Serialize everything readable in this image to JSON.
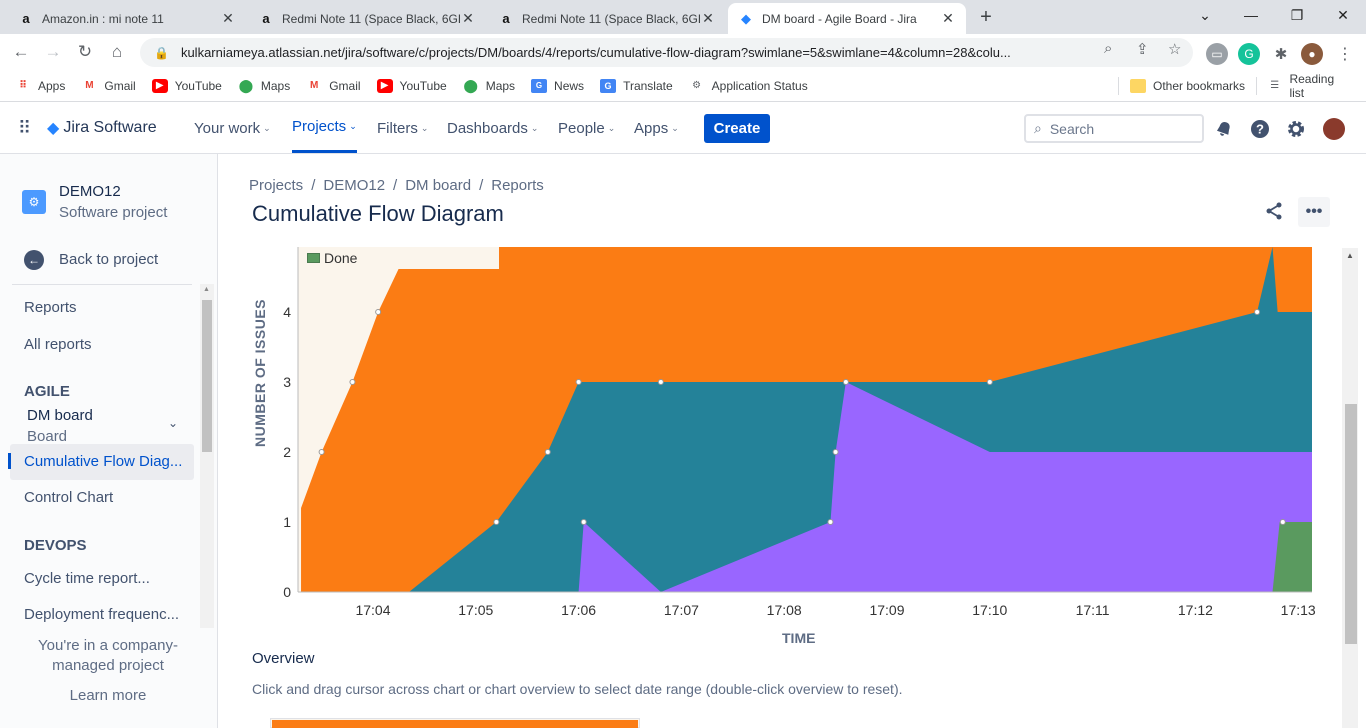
{
  "browser": {
    "tabs": [
      {
        "icon": "amazon-icon",
        "title": "Amazon.in : mi note 11",
        "active": false
      },
      {
        "icon": "amazon-icon",
        "title": "Redmi Note 11 (Space Black, 6GB",
        "active": false
      },
      {
        "icon": "amazon-icon",
        "title": "Redmi Note 11 (Space Black, 6GB",
        "active": false
      },
      {
        "icon": "jira-icon",
        "title": "DM board - Agile Board - Jira",
        "active": true
      }
    ],
    "url": "kulkarniameya.atlassian.net/jira/software/c/projects/DM/boards/4/reports/cumulative-flow-diagram?swimlane=5&swimlane=4&column=28&colu...",
    "bookmarks": [
      "Apps",
      "Gmail",
      "YouTube",
      "Maps",
      "Gmail",
      "YouTube",
      "Maps",
      "News",
      "Translate",
      "Application Status"
    ],
    "other_bookmarks": "Other bookmarks",
    "reading_list": "Reading list"
  },
  "jira": {
    "product": "Jira Software",
    "nav": [
      "Your work",
      "Projects",
      "Filters",
      "Dashboards",
      "People",
      "Apps"
    ],
    "active_nav": "Projects",
    "create": "Create",
    "search_placeholder": "Search"
  },
  "sidebar": {
    "project_name": "DEMO12",
    "project_type": "Software project",
    "back": "Back to project",
    "reports": "Reports",
    "all_reports": "All reports",
    "agile_head": "AGILE",
    "board_name": "DM board",
    "board_sub": "Board",
    "cfd": "Cumulative Flow Diag...",
    "control_chart": "Control Chart",
    "devops_head": "DEVOPS",
    "cycle_time": "Cycle time report...",
    "deployment": "Deployment frequenc...",
    "company_managed": "You're in a company-managed project",
    "learn_more": "Learn more"
  },
  "main": {
    "breadcrumbs": [
      "Projects",
      "DEMO12",
      "DM board",
      "Reports"
    ],
    "title": "Cumulative Flow Diagram",
    "overview_heading": "Overview",
    "overview_text": "Click and drag cursor across chart or chart overview to select date range (double-click overview to reset)."
  },
  "chart_data": {
    "type": "area",
    "xlabel": "TIME",
    "ylabel": "NUMBER OF ISSUES",
    "x_ticks": [
      "17:04",
      "17:05",
      "17:06",
      "17:07",
      "17:08",
      "17:09",
      "17:10",
      "17:11",
      "17:12",
      "17:13"
    ],
    "y_ticks": [
      0,
      1,
      2,
      3,
      4
    ],
    "legend": [
      "Done"
    ],
    "colors": {
      "done": "#5a9a5f",
      "in_review": "#9966ff",
      "in_progress": "#248299",
      "to_do": "#fb7c14",
      "background": "#fbf5ec"
    },
    "series": [
      {
        "name": "Done",
        "points": [
          [
            "17:03.3",
            0
          ],
          [
            "17:12.75",
            0
          ],
          [
            "17:12.82",
            1
          ],
          [
            "17:13.25",
            1
          ]
        ]
      },
      {
        "points": [
          [
            "17:06",
            0
          ],
          [
            "17:06.05",
            1
          ],
          [
            "17:06.8",
            0
          ],
          [
            "17:08.45",
            1
          ],
          [
            "17:08.5",
            2
          ],
          [
            "17:08.6",
            3
          ],
          [
            "17:10",
            2
          ],
          [
            "17:13.25",
            2
          ]
        ]
      },
      {
        "points": [
          [
            "17:04.35",
            0
          ],
          [
            "17:05.2",
            1
          ],
          [
            "17:05.7",
            2
          ],
          [
            "17:06",
            3
          ],
          [
            "17:10",
            3
          ],
          [
            "17:12.6",
            4
          ],
          [
            "17:12.75",
            5
          ],
          [
            "17:12.8",
            4
          ],
          [
            "17:13.25",
            4
          ]
        ]
      },
      {
        "points": [
          [
            "17:03.3",
            1.2
          ],
          [
            "17:03.5",
            2
          ],
          [
            "17:03.8",
            3
          ],
          [
            "17:04.05",
            4
          ],
          [
            "17:04.35",
            5
          ],
          [
            "17:13.25",
            5
          ]
        ]
      }
    ],
    "markers": [
      [
        "17:03.5",
        2
      ],
      [
        "17:03.8",
        3
      ],
      [
        "17:04.05",
        4
      ],
      [
        "17:05.2",
        1
      ],
      [
        "17:05.7",
        2
      ],
      [
        "17:06",
        3
      ],
      [
        "17:06.05",
        1
      ],
      [
        "17:06.8",
        3
      ],
      [
        "17:08.45",
        1
      ],
      [
        "17:08.5",
        2
      ],
      [
        "17:08.6",
        3
      ],
      [
        "17:10",
        3
      ],
      [
        "17:12.6",
        4
      ],
      [
        "17:12.85",
        1
      ]
    ]
  }
}
